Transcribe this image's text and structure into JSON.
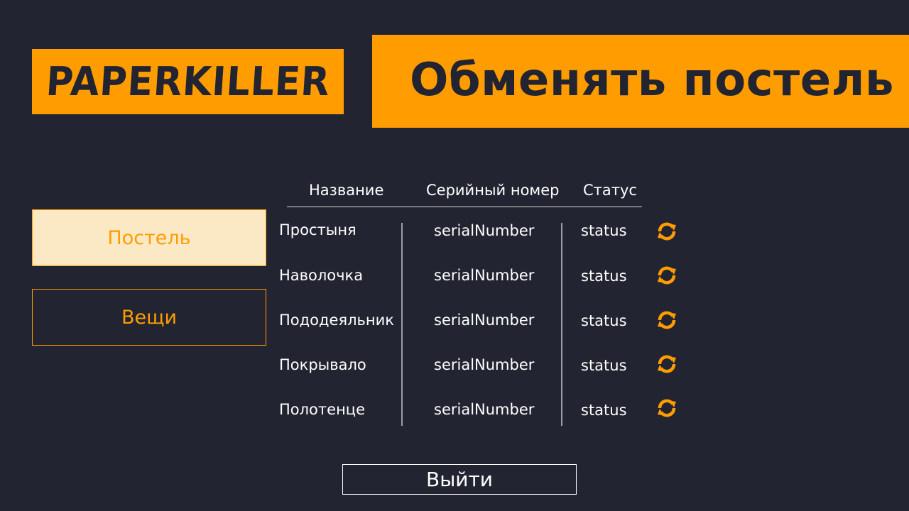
{
  "logo": {
    "text": "PAPERKILLER"
  },
  "page_title": "Обменять постель",
  "categories": [
    {
      "label": "Постель",
      "active": true
    },
    {
      "label": "Вещи",
      "active": false
    }
  ],
  "table": {
    "headers": [
      "Название",
      "Серийный номер",
      "Статус"
    ],
    "rows": [
      {
        "name": "Простыня",
        "serial": "serialNumber",
        "status": "status",
        "action_icon": "refresh-icon"
      },
      {
        "name": "Наволочка",
        "serial": "serialNumber",
        "status": "status",
        "action_icon": "refresh-icon"
      },
      {
        "name": "Пододеяльник",
        "serial": "serialNumber",
        "status": "status",
        "action_icon": "refresh-icon"
      },
      {
        "name": "Покрывало",
        "serial": "serialNumber",
        "status": "status",
        "action_icon": "refresh-icon"
      },
      {
        "name": "Полотенце",
        "serial": "serialNumber",
        "status": "status",
        "action_icon": "refresh-icon"
      }
    ]
  },
  "exit_button": {
    "label": "Выйти"
  },
  "colors": {
    "background": "#222431",
    "accent": "#ff9d00",
    "active_category_bg": "#fbe9c6",
    "text": "#ffffff"
  }
}
